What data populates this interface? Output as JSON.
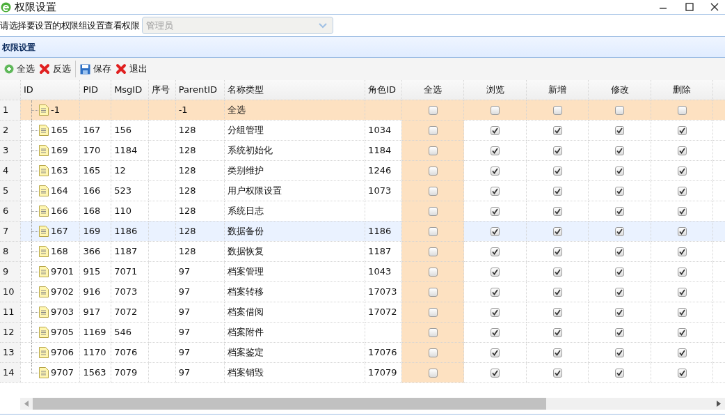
{
  "window": {
    "title": "权限设置"
  },
  "filter": {
    "label": "请选择要设置的权限组设置查看权限",
    "value": "管理员"
  },
  "panel": {
    "title": "权限设置"
  },
  "toolbar": [
    {
      "kind": "add",
      "label": "全选"
    },
    {
      "kind": "cancel",
      "label": "反选"
    },
    {
      "kind": "save",
      "label": "保存"
    },
    {
      "kind": "cancel",
      "label": "退出"
    }
  ],
  "columns": [
    "ID",
    "PID",
    "MsgID",
    "序号",
    "ParentID",
    "名称类型",
    "角色ID",
    "全选",
    "浏览",
    "新增",
    "修改",
    "删除"
  ],
  "rows": [
    {
      "num": "1",
      "id": "-1",
      "pid": "",
      "msgid": "",
      "parent_id": "-1",
      "name": "全选",
      "role_id": "",
      "selected": true,
      "hovered": false,
      "checks": [
        false,
        false,
        false,
        false,
        false
      ]
    },
    {
      "num": "2",
      "id": "165",
      "pid": "167",
      "msgid": "156",
      "parent_id": "128",
      "name": "分组管理",
      "role_id": "1034",
      "selected": false,
      "hovered": false,
      "checks": [
        false,
        true,
        true,
        true,
        true
      ]
    },
    {
      "num": "3",
      "id": "169",
      "pid": "170",
      "msgid": "1184",
      "parent_id": "128",
      "name": "系统初始化",
      "role_id": "1184",
      "selected": false,
      "hovered": false,
      "checks": [
        false,
        true,
        true,
        true,
        true
      ]
    },
    {
      "num": "4",
      "id": "163",
      "pid": "165",
      "msgid": "12",
      "parent_id": "128",
      "name": "类别维护",
      "role_id": "1246",
      "selected": false,
      "hovered": false,
      "checks": [
        false,
        true,
        true,
        true,
        true
      ]
    },
    {
      "num": "5",
      "id": "164",
      "pid": "166",
      "msgid": "523",
      "parent_id": "128",
      "name": "用户权限设置",
      "role_id": "1073",
      "selected": false,
      "hovered": false,
      "checks": [
        false,
        true,
        true,
        true,
        true
      ]
    },
    {
      "num": "6",
      "id": "166",
      "pid": "168",
      "msgid": "110",
      "parent_id": "128",
      "name": "系统日志",
      "role_id": "",
      "selected": false,
      "hovered": false,
      "checks": [
        false,
        true,
        true,
        true,
        true
      ]
    },
    {
      "num": "7",
      "id": "167",
      "pid": "169",
      "msgid": "1186",
      "parent_id": "128",
      "name": "数据备份",
      "role_id": "1186",
      "selected": false,
      "hovered": true,
      "checks": [
        false,
        true,
        true,
        true,
        true
      ]
    },
    {
      "num": "8",
      "id": "168",
      "pid": "366",
      "msgid": "1187",
      "parent_id": "128",
      "name": "数据恢复",
      "role_id": "1187",
      "selected": false,
      "hovered": false,
      "checks": [
        false,
        true,
        true,
        true,
        true
      ]
    },
    {
      "num": "9",
      "id": "9701",
      "pid": "915",
      "msgid": "7071",
      "parent_id": "97",
      "name": "档案管理",
      "role_id": "1043",
      "selected": false,
      "hovered": false,
      "checks": [
        false,
        true,
        true,
        true,
        true
      ]
    },
    {
      "num": "10",
      "id": "9702",
      "pid": "916",
      "msgid": "7073",
      "parent_id": "97",
      "name": "档案转移",
      "role_id": "17073",
      "selected": false,
      "hovered": false,
      "checks": [
        false,
        true,
        true,
        true,
        true
      ]
    },
    {
      "num": "11",
      "id": "9703",
      "pid": "917",
      "msgid": "7072",
      "parent_id": "97",
      "name": "档案借阅",
      "role_id": "17072",
      "selected": false,
      "hovered": false,
      "checks": [
        false,
        true,
        true,
        true,
        true
      ]
    },
    {
      "num": "12",
      "id": "9705",
      "pid": "1169",
      "msgid": "546",
      "parent_id": "97",
      "name": "档案附件",
      "role_id": "",
      "selected": false,
      "hovered": false,
      "checks": [
        false,
        true,
        true,
        true,
        true
      ]
    },
    {
      "num": "13",
      "id": "9706",
      "pid": "1170",
      "msgid": "7076",
      "parent_id": "97",
      "name": "档案鉴定",
      "role_id": "17076",
      "selected": false,
      "hovered": false,
      "checks": [
        false,
        true,
        true,
        true,
        true
      ]
    },
    {
      "num": "14",
      "id": "9707",
      "pid": "1563",
      "msgid": "7079",
      "parent_id": "97",
      "name": "档案销毁",
      "role_id": "17079",
      "selected": false,
      "hovered": false,
      "checks": [
        false,
        true,
        true,
        true,
        true
      ]
    }
  ]
}
